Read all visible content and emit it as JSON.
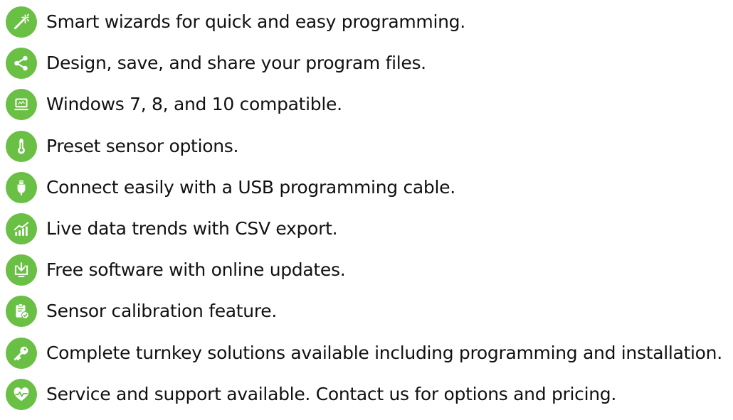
{
  "colors": {
    "accent": "#6abf45",
    "text": "#111111",
    "background": "#ffffff"
  },
  "features": [
    {
      "icon": "magic-wand-icon",
      "text": "Smart wizards for quick and easy programming."
    },
    {
      "icon": "share-icon",
      "text": "Design, save, and share your program files."
    },
    {
      "icon": "laptop-icon",
      "text": "Windows 7, 8, and 10 compatible."
    },
    {
      "icon": "thermometer-icon",
      "text": "Preset sensor options."
    },
    {
      "icon": "usb-plug-icon",
      "text": "Connect easily with a USB programming cable."
    },
    {
      "icon": "trend-chart-icon",
      "text": "Live data trends with CSV export."
    },
    {
      "icon": "download-monitor-icon",
      "text": "Free software with online updates."
    },
    {
      "icon": "clipboard-check-icon",
      "text": "Sensor calibration feature."
    },
    {
      "icon": "key-icon",
      "text": "Complete turnkey solutions available including programming and installation."
    },
    {
      "icon": "heart-pulse-icon",
      "text": "Service and support available. Contact us for options and pricing."
    }
  ]
}
